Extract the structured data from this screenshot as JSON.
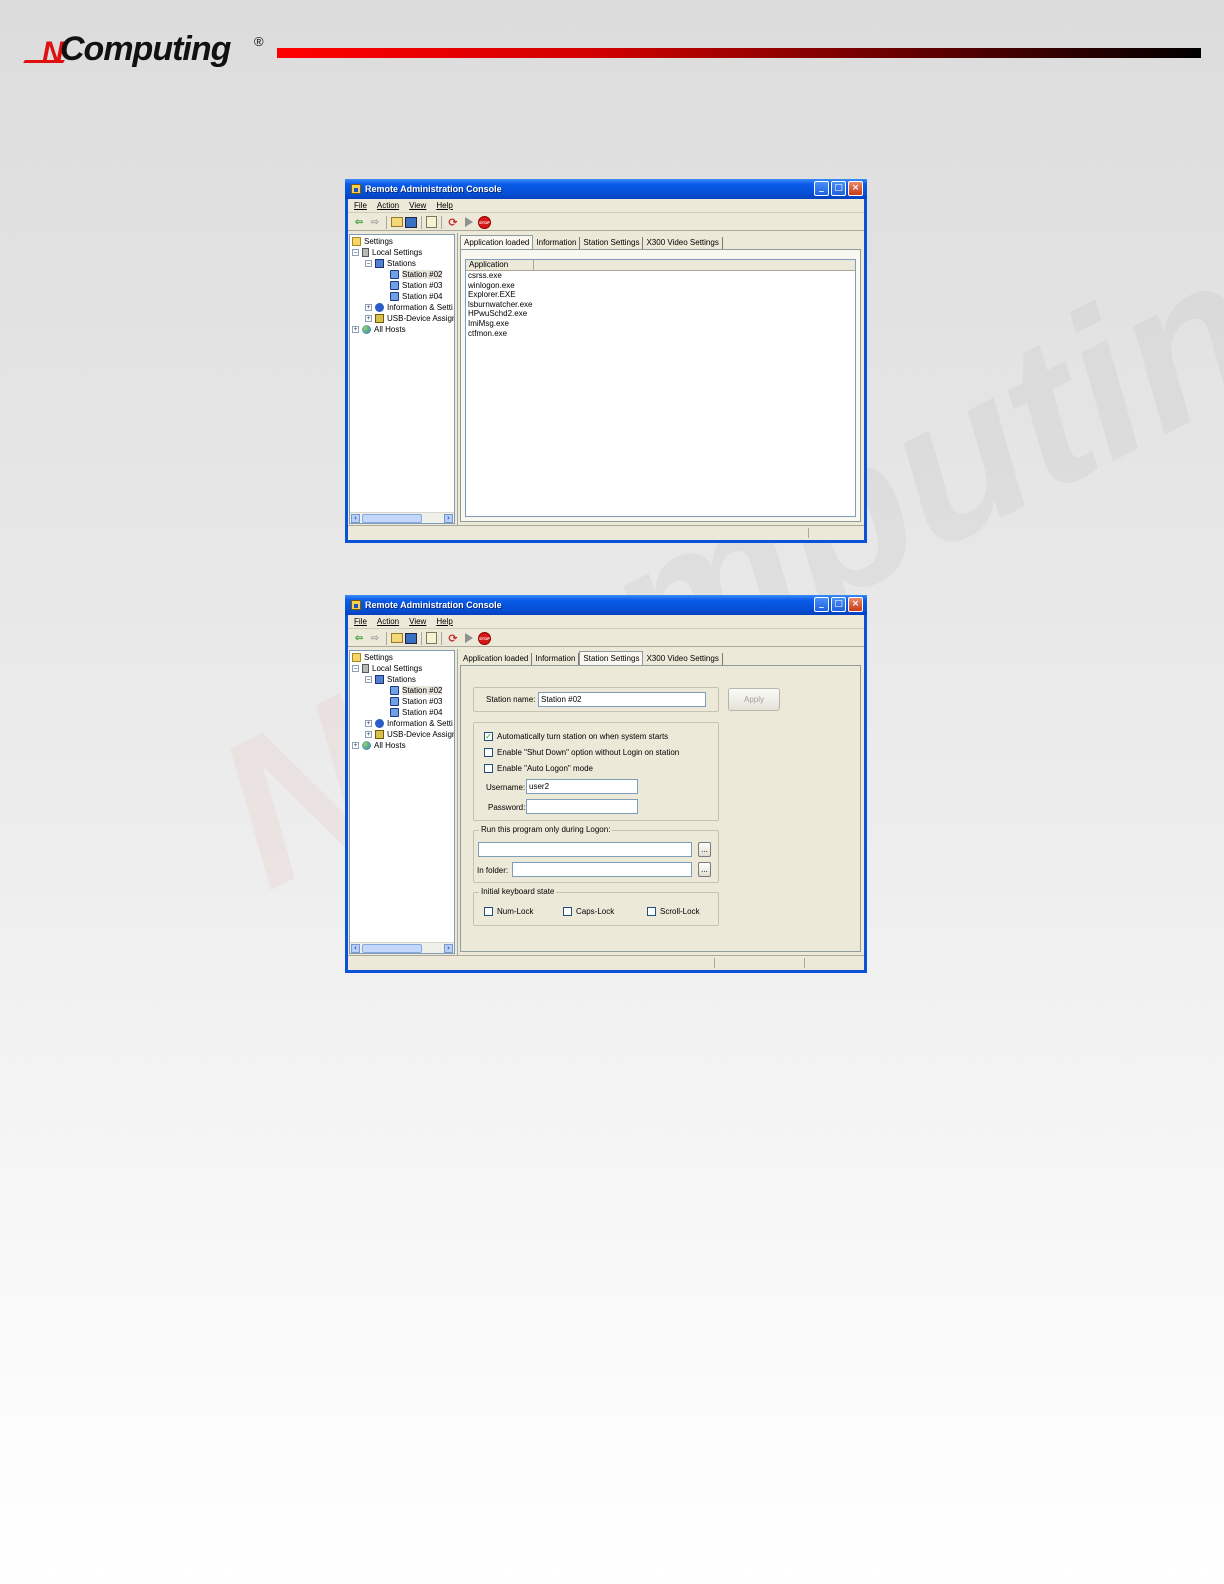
{
  "brand": {
    "logo_n": "N",
    "logo_word": "Computing",
    "logo_reg": "®"
  },
  "colors": {
    "accent_red": "#e01010",
    "xp_blue": "#0a53d8",
    "window_face": "#ece9d8"
  },
  "window1": {
    "title": "Remote Administration Console",
    "menu": [
      "File",
      "Action",
      "View",
      "Help"
    ],
    "tree": [
      {
        "label": "Settings",
        "icon": "folder-icon"
      },
      {
        "label": "Local Settings",
        "icon": "server-icon"
      },
      {
        "label": "Stations",
        "icon": "network-icon"
      },
      {
        "label": "Station #02",
        "icon": "monitor-icon"
      },
      {
        "label": "Station #03",
        "icon": "monitor-icon"
      },
      {
        "label": "Station #04",
        "icon": "monitor-icon"
      },
      {
        "label": "Information & Setti",
        "icon": "info-icon"
      },
      {
        "label": "USB-Device Assigni",
        "icon": "usb-icon"
      },
      {
        "label": "All Hosts",
        "icon": "globe-icon"
      }
    ],
    "tabs": [
      "Application loaded",
      "Information",
      "Station Settings",
      "X300 Video Settings"
    ],
    "column_header": "Application",
    "applications": [
      "csrss.exe",
      "winlogon.exe",
      "Explorer.EXE",
      "lsburnwatcher.exe",
      "HPwuSchd2.exe",
      "ImiMsg.exe",
      "ctfmon.exe"
    ]
  },
  "window2": {
    "title": "Remote Administration Console",
    "menu": [
      "File",
      "Action",
      "View",
      "Help"
    ],
    "tree": [
      {
        "label": "Settings",
        "icon": "folder-icon"
      },
      {
        "label": "Local Settings",
        "icon": "server-icon"
      },
      {
        "label": "Stations",
        "icon": "network-icon"
      },
      {
        "label": "Station #02",
        "icon": "monitor-icon"
      },
      {
        "label": "Station #03",
        "icon": "monitor-icon"
      },
      {
        "label": "Station #04",
        "icon": "monitor-icon"
      },
      {
        "label": "Information & Setti",
        "icon": "info-icon"
      },
      {
        "label": "USB-Device Assigni",
        "icon": "usb-icon"
      },
      {
        "label": "All Hosts",
        "icon": "globe-icon"
      }
    ],
    "tabs": [
      "Application loaded",
      "Information",
      "Station Settings",
      "X300 Video Settings"
    ],
    "form": {
      "station_name_label": "Station name:",
      "station_name_value": "Station #02",
      "apply_label": "Apply",
      "auto_on_label": "Automatically turn station on when system starts",
      "auto_on_checked": true,
      "shutdown_label": "Enable \"Shut Down\" option without Login on station",
      "autologon_label": "Enable \"Auto Logon\" mode",
      "username_label": "Username:",
      "username_value": "user2",
      "password_label": "Password:",
      "password_value": "",
      "run_group_label": "Run this program only during Logon:",
      "program_value": "",
      "infolder_label": "In folder:",
      "infolder_value": "",
      "browse_label": "...",
      "keyboard_group_label": "Initial keyboard state",
      "numlock_label": "Num-Lock",
      "capslock_label": "Caps-Lock",
      "scrolllock_label": "Scroll-Lock"
    }
  }
}
